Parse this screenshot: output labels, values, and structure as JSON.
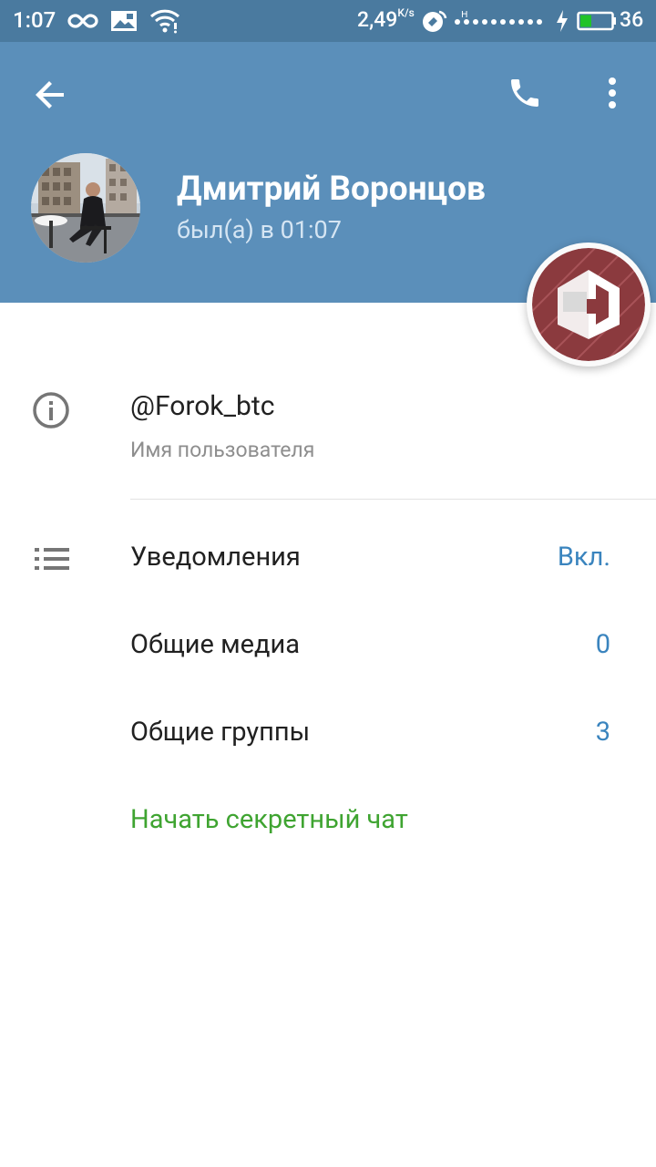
{
  "status_bar": {
    "time": "1:07",
    "speed": "2,49",
    "speed_unit": "K/s",
    "battery": "36"
  },
  "header": {
    "profile_name": "Дмитрий Воронцов",
    "profile_status": "был(а) в 01:07"
  },
  "info": {
    "username": "@Forok_btc",
    "username_label": "Имя пользователя"
  },
  "rows": {
    "notifications": {
      "label": "Уведомления",
      "value": "Вкл."
    },
    "shared_media": {
      "label": "Общие медиа",
      "value": "0"
    },
    "shared_groups": {
      "label": "Общие группы",
      "value": "3"
    }
  },
  "secret_chat_label": "Начать секретный чат",
  "colors": {
    "header": "#5b8fba",
    "status_bar": "#4a7a9f",
    "accent_blue": "#3a84be",
    "accent_green": "#3fa431"
  }
}
